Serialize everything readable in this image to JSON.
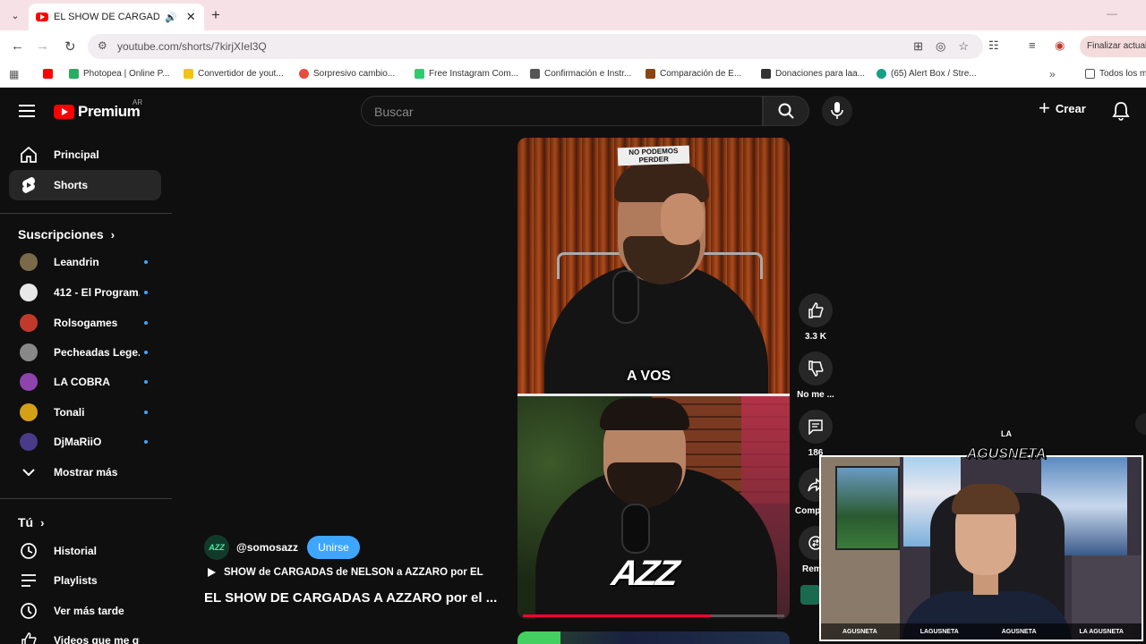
{
  "browser": {
    "tab_title": "EL SHOW DE CARGADAS A",
    "url": "youtube.com/shorts/7kirjXIel3Q",
    "finalizar_label": "Finalizar actual",
    "bookmarks": [
      {
        "label": "",
        "color": "#ff0000"
      },
      {
        "label": "Photopea | Online P...",
        "color": "#27ae60"
      },
      {
        "label": "Convertidor de yout...",
        "color": "#f1c40f"
      },
      {
        "label": "Sorpresivo cambio...",
        "color": "#e74c3c"
      },
      {
        "label": "Free Instagram Com...",
        "color": "#2ecc71"
      },
      {
        "label": "Confirmación e Instr...",
        "color": "#555555"
      },
      {
        "label": "Comparación de E...",
        "color": "#8b4513"
      },
      {
        "label": "Donaciones para laa...",
        "color": "#333333"
      },
      {
        "label": "(65) Alert Box / Stre...",
        "color": "#16a085"
      }
    ],
    "all_bookmarks_label": "Todos los m"
  },
  "youtube": {
    "logo_text": "Premium",
    "country": "AR",
    "search_placeholder": "Buscar",
    "create_label": "Crear",
    "sidebar": {
      "main": [
        {
          "label": "Principal",
          "icon": "home-icon"
        },
        {
          "label": "Shorts",
          "icon": "shorts-icon",
          "active": true
        }
      ],
      "subscriptions_heading": "Suscripciones",
      "subscriptions": [
        {
          "label": "Leandrin",
          "color": "#7a6a4a"
        },
        {
          "label": "412 - El Program...",
          "color": "#e8e8e8"
        },
        {
          "label": "Rolsogames",
          "color": "#c0392b"
        },
        {
          "label": "Pecheadas Lege...",
          "color": "#888888"
        },
        {
          "label": "LA COBRA",
          "color": "#8e44ad"
        },
        {
          "label": "Tonali",
          "color": "#d4a017"
        },
        {
          "label": "DjMaRiiO",
          "color": "#4a3a8a"
        }
      ],
      "show_more_label": "Mostrar más",
      "you_heading": "Tú",
      "you_items": [
        {
          "label": "Historial",
          "icon": "history-icon"
        },
        {
          "label": "Playlists",
          "icon": "playlists-icon"
        },
        {
          "label": "Ver más tarde",
          "icon": "watch-later-icon"
        },
        {
          "label": "Videos que me gus",
          "icon": "liked-icon"
        }
      ]
    },
    "short": {
      "sign_text": "NO PODEMOS PERDER",
      "caption": "A VOS",
      "overlay_logo": "AZZ",
      "channel_avatar": "AZZ",
      "channel_handle": "@somosazz",
      "join_label": "Unirse",
      "description": "SHOW de CARGADAS de NELSON a AZZARO por EL",
      "title": "EL SHOW DE CARGADAS A AZZARO por el ...",
      "progress": 0.72,
      "actions": {
        "likes": "3.3 K",
        "dislike_label": "No me ...",
        "comments": "186",
        "share_label": "Compartir",
        "remix_label": "Remix"
      }
    }
  },
  "webcam": {
    "badge_top": "LA",
    "badge_main": "AGUSNETA",
    "socials": [
      "AGUSNETA",
      "LAGUSNETA",
      "AGUSNETA",
      "LA AGUSNETA"
    ]
  }
}
